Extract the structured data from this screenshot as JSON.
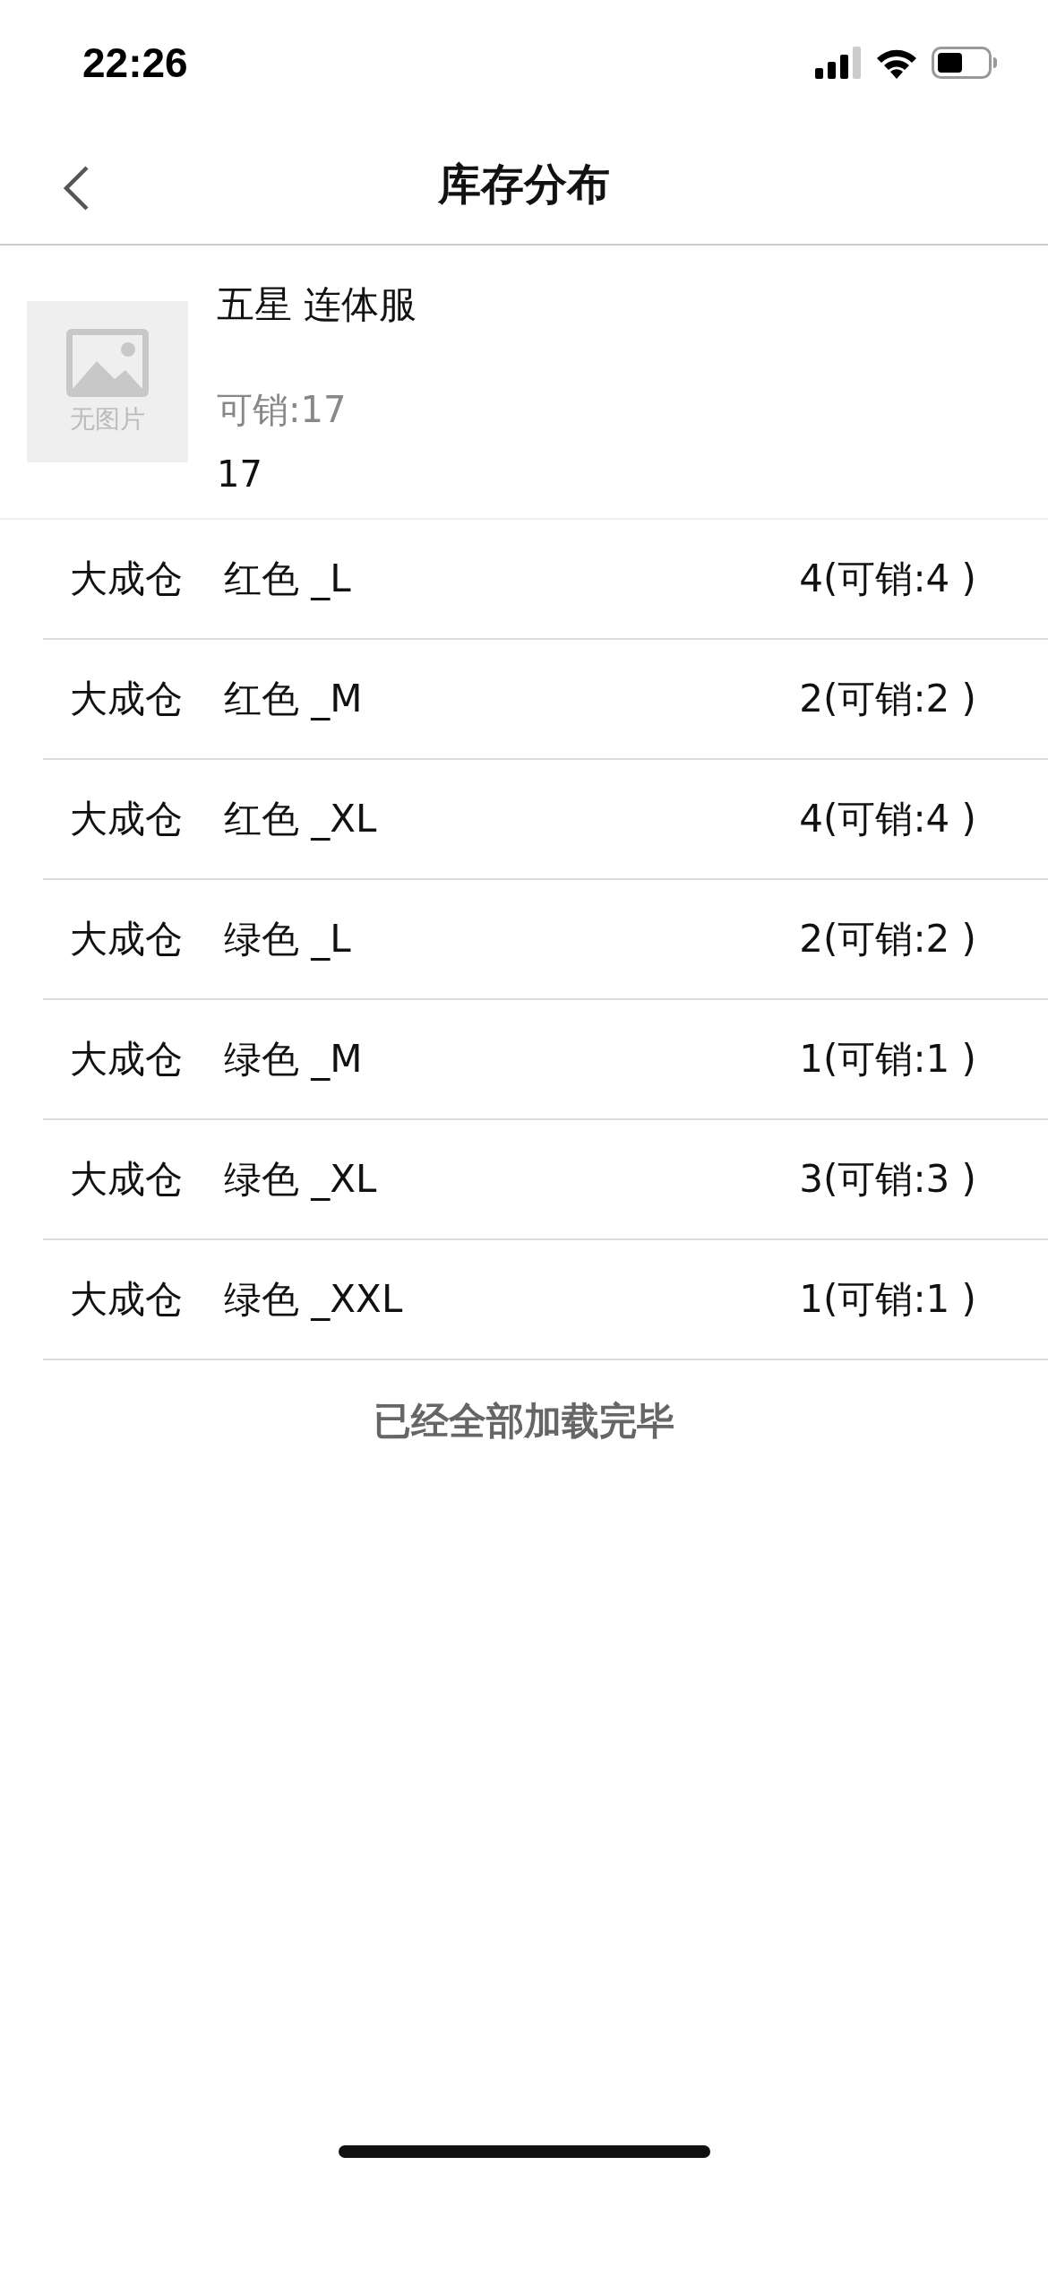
{
  "status_bar": {
    "time": "22:26"
  },
  "nav": {
    "title": "库存分布"
  },
  "product": {
    "image_label": "无图片",
    "name": "五星 连体服",
    "sellable": "可销:17",
    "total": "17"
  },
  "rows": [
    {
      "warehouse": "大成仓",
      "variant": "红色 _L",
      "stock": "4(可销:4 )"
    },
    {
      "warehouse": "大成仓",
      "variant": "红色 _M",
      "stock": "2(可销:2 )"
    },
    {
      "warehouse": "大成仓",
      "variant": "红色 _XL",
      "stock": "4(可销:4 )"
    },
    {
      "warehouse": "大成仓",
      "variant": "绿色 _L",
      "stock": "2(可销:2 )"
    },
    {
      "warehouse": "大成仓",
      "variant": "绿色 _M",
      "stock": "1(可销:1 )"
    },
    {
      "warehouse": "大成仓",
      "variant": "绿色 _XL",
      "stock": "3(可销:3 )"
    },
    {
      "warehouse": "大成仓",
      "variant": "绿色 _XXL",
      "stock": "1(可销:1 )"
    }
  ],
  "footer": "已经全部加载完毕"
}
